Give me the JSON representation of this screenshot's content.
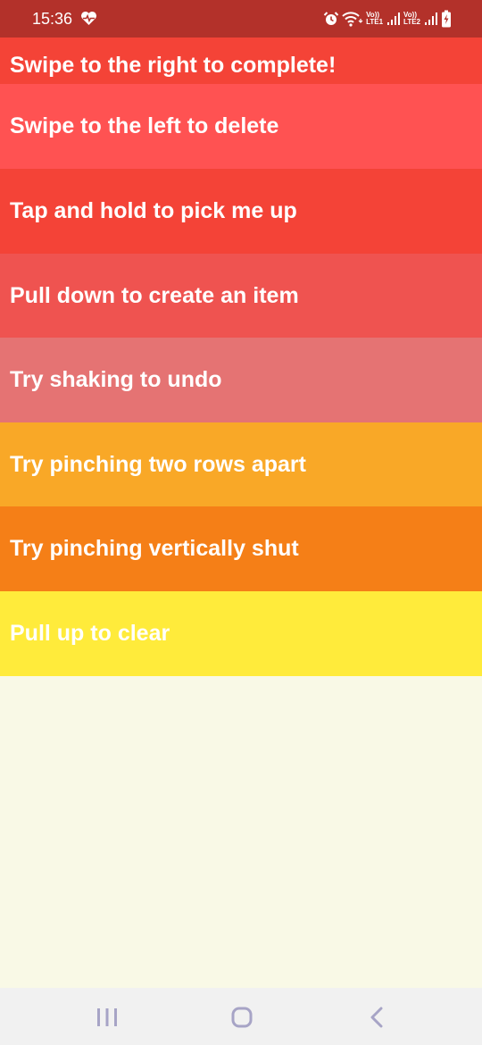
{
  "status_bar": {
    "time": "15:36",
    "sim1_label_top": "Vo))",
    "sim1_label_bottom": "LTE1",
    "sim2_label_top": "Vo))",
    "sim2_label_bottom": "LTE2",
    "icons": [
      "heart-monitor-icon",
      "alarm-icon",
      "wifi-icon",
      "signal-icon",
      "battery-icon"
    ]
  },
  "list": {
    "items": [
      {
        "label": "Swipe to the right to complete!",
        "color": "#f44337"
      },
      {
        "label": "Swipe to the left to delete",
        "color": "#ff5252"
      },
      {
        "label": "Tap and hold to pick me up",
        "color": "#f44337"
      },
      {
        "label": "Pull down to create an item",
        "color": "#ef5350"
      },
      {
        "label": "Try shaking to undo",
        "color": "#e57373"
      },
      {
        "label": "Try pinching two rows apart",
        "color": "#f9a827"
      },
      {
        "label": "Try pinching vertically shut",
        "color": "#f57f17"
      },
      {
        "label": "Pull up to clear",
        "color": "#ffeb3b"
      }
    ]
  },
  "background_color": "#f9f9e6",
  "nav_bar": {
    "icons": [
      "recent-apps-icon",
      "home-icon",
      "back-icon"
    ],
    "icon_color": "#a7a4c6"
  }
}
